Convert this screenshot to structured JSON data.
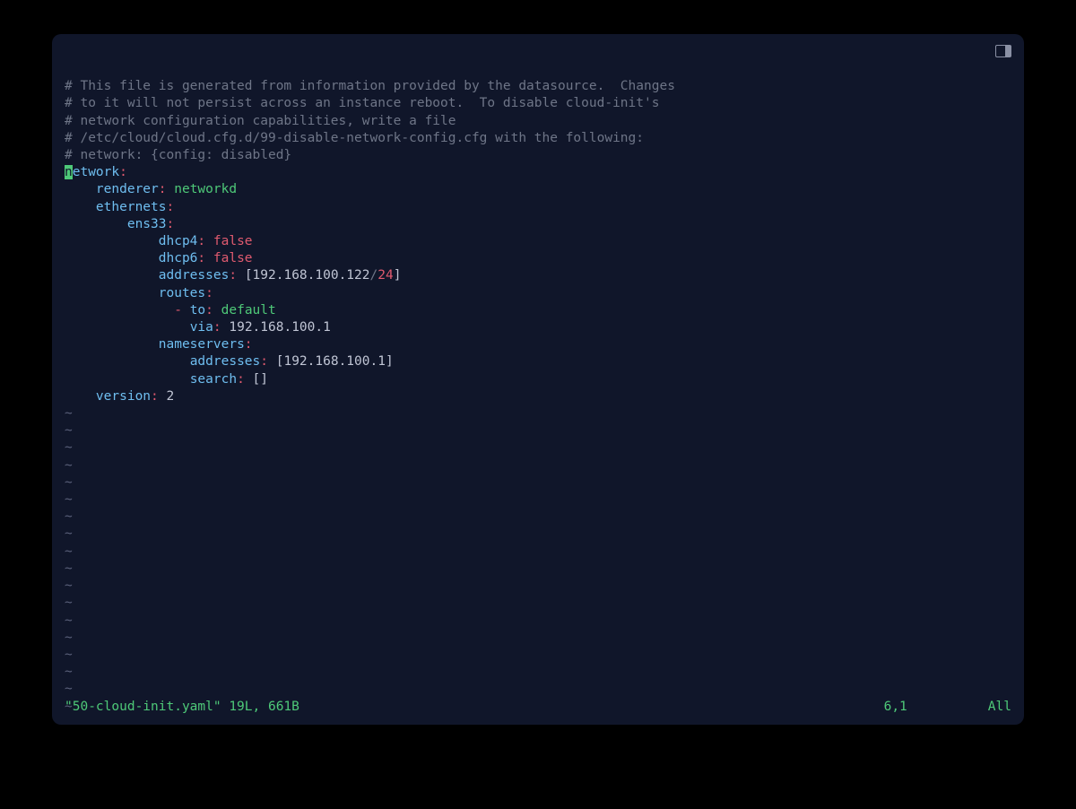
{
  "comments": [
    "# This file is generated from information provided by the datasource.  Changes",
    "# to it will not persist across an instance reboot.  To disable cloud-init's",
    "# network configuration capabilities, write a file",
    "# /etc/cloud/cloud.cfg.d/99-disable-network-config.cfg with the following:",
    "# network: {config: disabled}"
  ],
  "yaml": {
    "network_key": "network",
    "renderer_key": "renderer",
    "renderer_val": "networkd",
    "ethernets_key": "ethernets",
    "iface_key": "ens33",
    "dhcp4_key": "dhcp4",
    "dhcp4_val": "false",
    "dhcp6_key": "dhcp6",
    "dhcp6_val": "false",
    "addresses_key": "addresses",
    "addr_ip": "192.168.100.122",
    "addr_prefix": "24",
    "routes_key": "routes",
    "to_key": "to",
    "to_val": "default",
    "via_key": "via",
    "via_val": "192.168.100.1",
    "nameservers_key": "nameservers",
    "ns_addresses_key": "addresses",
    "ns_addr_val": "192.168.100.1",
    "search_key": "search",
    "version_key": "version",
    "version_val": "2",
    "cursor_char": "n",
    "cursor_rest": "etwork"
  },
  "tilde": "~",
  "status": {
    "file": "\"50-cloud-init.yaml\" 19L, 661B",
    "position": "6,1",
    "scroll": "All"
  }
}
